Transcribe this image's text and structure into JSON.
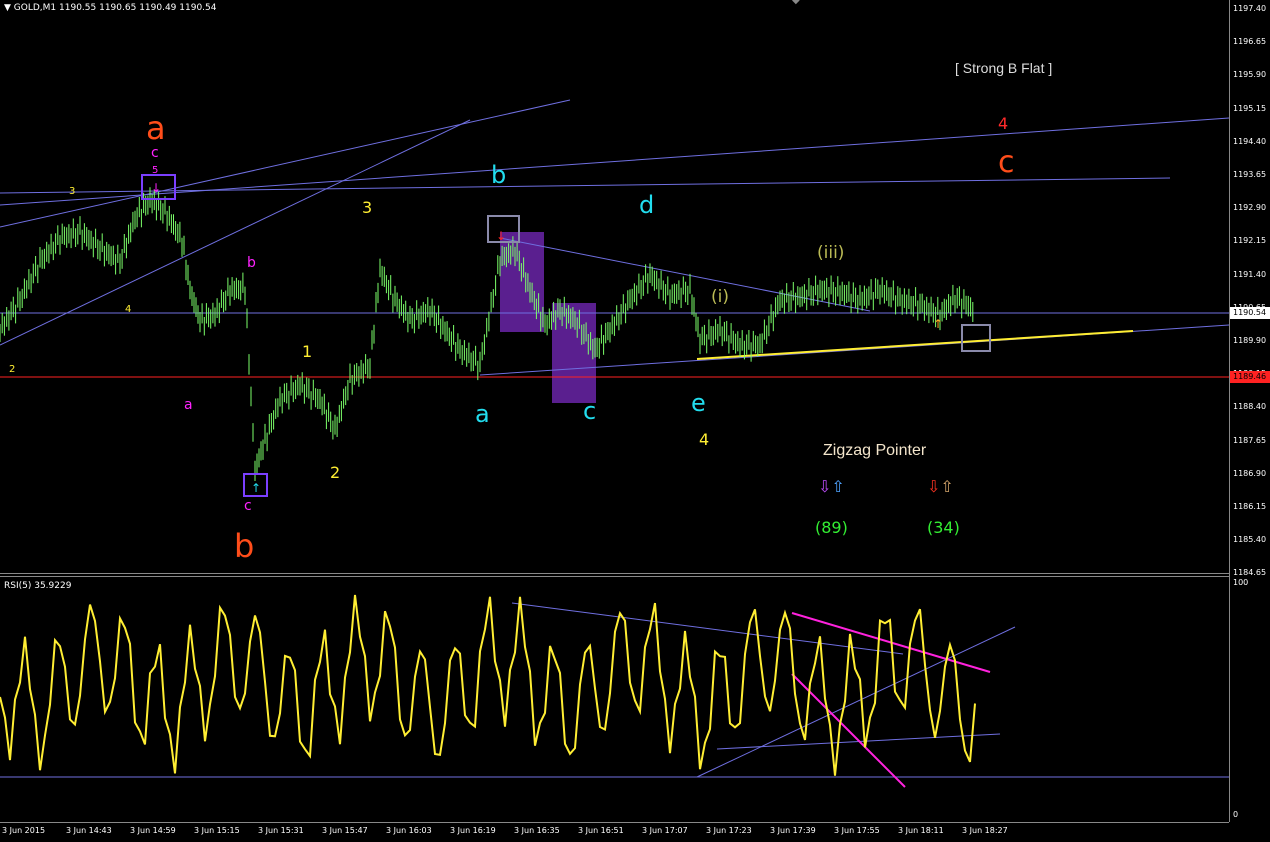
{
  "header": {
    "symbol": "GOLD,M1",
    "ohlc": "1190.55 1190.65 1190.49 1190.54"
  },
  "price_scale": {
    "ticks": [
      "1197.40",
      "1196.65",
      "1195.90",
      "1195.15",
      "1194.40",
      "1193.65",
      "1192.90",
      "1192.15",
      "1191.40",
      "1190.65",
      "1189.90",
      "1189.15",
      "1188.40",
      "1187.65",
      "1186.90",
      "1186.15",
      "1185.40",
      "1184.65"
    ],
    "current_price": "1190.54",
    "red_line_price": "1189.46"
  },
  "rsi_panel": {
    "title": "RSI(5) 35.9229",
    "scale_top": "100",
    "scale_bottom": "0"
  },
  "time_scale": {
    "ticks": [
      "3 Jun 2015",
      "3 Jun 14:43",
      "3 Jun 14:59",
      "3 Jun 15:15",
      "3 Jun 15:31",
      "3 Jun 15:47",
      "3 Jun 16:03",
      "3 Jun 16:19",
      "3 Jun 16:35",
      "3 Jun 16:51",
      "3 Jun 17:07",
      "3 Jun 17:23",
      "3 Jun 17:39",
      "3 Jun 17:55",
      "3 Jun 18:11",
      "3 Jun 18:27"
    ]
  },
  "annotations": {
    "strong_b_flat": "[ Strong B Flat ]",
    "wave_labels": [
      {
        "text": "a",
        "color": "#ff4d1a"
      },
      {
        "text": "b",
        "color": "#ff4d1a"
      },
      {
        "text": "c",
        "color": "#ff4d1a"
      },
      {
        "text": "4",
        "color": "#ff2a2a"
      },
      {
        "text": "c",
        "color": "#ff22ff"
      },
      {
        "text": "5",
        "color": "#ff22ff"
      },
      {
        "text": "b",
        "color": "#ff22ff"
      },
      {
        "text": "a",
        "color": "#ff22ff"
      },
      {
        "text": "c",
        "color": "#ff22ff"
      },
      {
        "text": "3",
        "color": "#ffee33"
      },
      {
        "text": "1",
        "color": "#ffee33"
      },
      {
        "text": "2",
        "color": "#ffee33"
      },
      {
        "text": "4",
        "color": "#ffee33"
      },
      {
        "text": "3",
        "color": "#ffee33"
      },
      {
        "text": "4",
        "color": "#ffee33"
      },
      {
        "text": "2",
        "color": "#ffee33"
      },
      {
        "text": "b",
        "color": "#22ddee"
      },
      {
        "text": "d",
        "color": "#22ddee"
      },
      {
        "text": "a",
        "color": "#22ddee"
      },
      {
        "text": "c",
        "color": "#22ddee"
      },
      {
        "text": "e",
        "color": "#22ddee"
      },
      {
        "text": "(iii)",
        "color": "#bbbb55"
      },
      {
        "text": "(i)",
        "color": "#bbbb55"
      }
    ]
  },
  "zigzag_pointer": {
    "title": "Zigzag Pointer",
    "left_arrows": "⇩⇧",
    "right_arrows": "⇩⇧",
    "left_value": "(89)",
    "right_value": "(34)"
  },
  "colors": {
    "candle": "#7cff6a",
    "rsi": "#ffee33",
    "trendline": "#6f6fe0",
    "support": "#ffee33",
    "red_line": "#ff2222",
    "pink_line": "#ff22dd"
  }
}
